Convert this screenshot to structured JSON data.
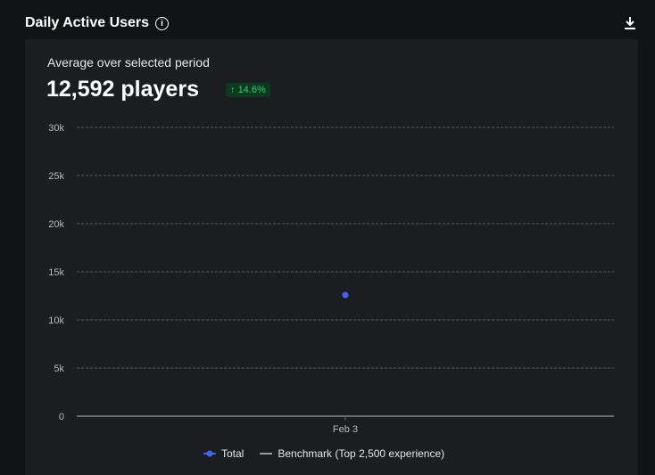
{
  "header": {
    "title": "Daily Active Users",
    "info_icon": "info-icon",
    "download_icon": "download-icon"
  },
  "summary": {
    "label": "Average over selected period",
    "value": "12,592 players",
    "change": "14.6%",
    "change_color": "#2fd06a"
  },
  "chart_data": {
    "type": "scatter",
    "title": "Daily Active Users",
    "categories": [
      "Feb 3"
    ],
    "series": [
      {
        "name": "Total",
        "color": "#3f63f5",
        "values": [
          12592
        ]
      },
      {
        "name": "Benchmark (Top 2,500 experience)",
        "color": "#9a9a9a",
        "values": []
      }
    ],
    "yticks": [
      "0",
      "5k",
      "10k",
      "15k",
      "20k",
      "25k",
      "30k"
    ],
    "ytick_values": [
      0,
      5000,
      10000,
      15000,
      20000,
      25000,
      30000
    ],
    "ylim": [
      0,
      30000
    ],
    "grid": true,
    "legend": "bottom-center"
  }
}
